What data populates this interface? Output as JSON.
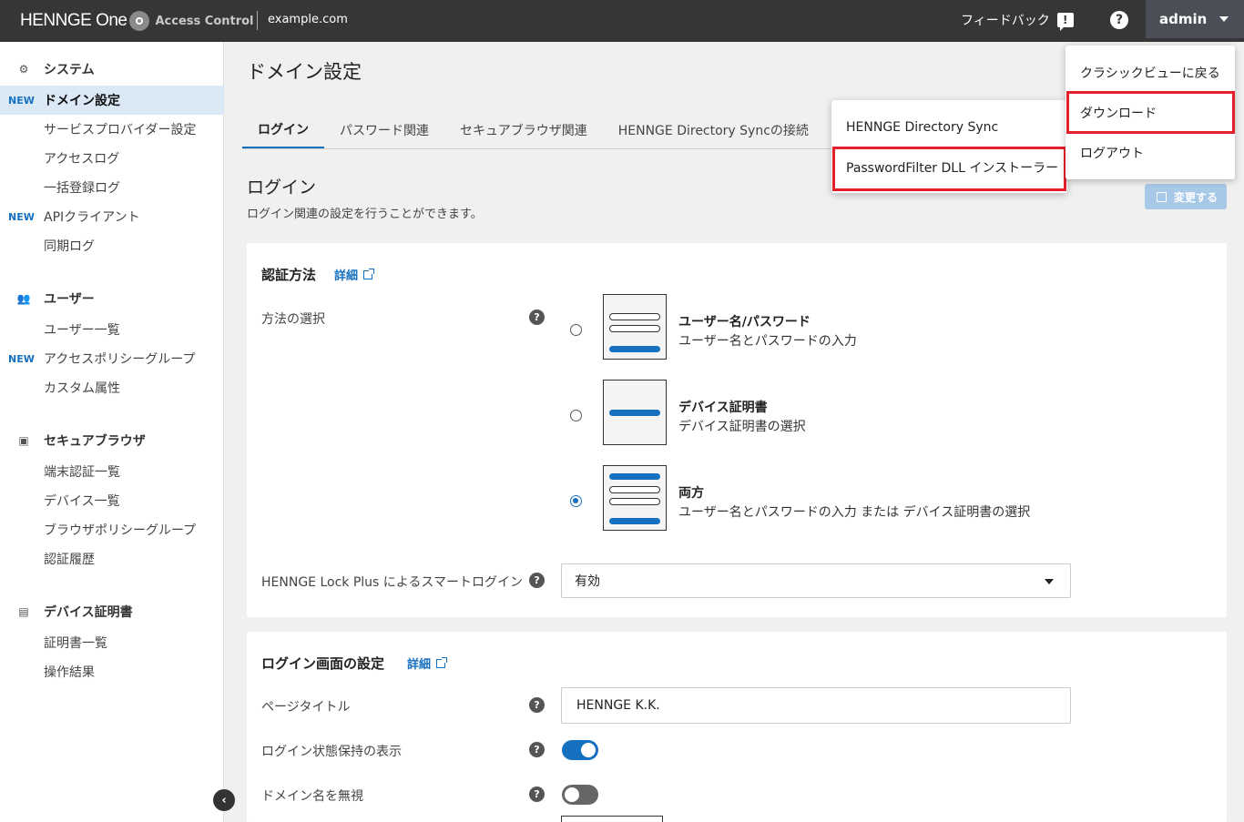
{
  "header": {
    "brand": "HENNGE One",
    "product": "Access Control",
    "domain": "example.com",
    "feedback_label": "フィードバック",
    "feedback_icon": "!",
    "help_icon": "?",
    "user_label": "admin"
  },
  "sidebar": {
    "new_tag": "NEW",
    "sections": [
      {
        "label": "システム",
        "icon": "gear-icon",
        "glyph": "⚙"
      },
      {
        "label": "ユーザー",
        "icon": "users-icon",
        "glyph": "👥"
      },
      {
        "label": "セキュアブラウザ",
        "icon": "browser-icon",
        "glyph": "▣"
      },
      {
        "label": "デバイス証明書",
        "icon": "certificate-icon",
        "glyph": "▤"
      }
    ],
    "items": [
      {
        "label": "ドメイン設定",
        "new": true,
        "active": true
      },
      {
        "label": "サービスプロバイダー設定"
      },
      {
        "label": "アクセスログ"
      },
      {
        "label": "一括登録ログ"
      },
      {
        "label": "APIクライアント",
        "new": true
      },
      {
        "label": "同期ログ"
      },
      {
        "label": "ユーザー一覧"
      },
      {
        "label": "アクセスポリシーグループ",
        "new": true
      },
      {
        "label": "カスタム属性"
      },
      {
        "label": "端末認証一覧"
      },
      {
        "label": "デバイス一覧"
      },
      {
        "label": "ブラウザポリシーグループ"
      },
      {
        "label": "認証履歴"
      },
      {
        "label": "証明書一覧"
      },
      {
        "label": "操作結果"
      }
    ],
    "collapse_glyph": "‹"
  },
  "main": {
    "page_title": "ドメイン設定",
    "tabs": [
      {
        "label": "ログイン",
        "active": true
      },
      {
        "label": "パスワード関連"
      },
      {
        "label": "セキュアブラウザ関連"
      },
      {
        "label": "HENNGE Directory Syncの接続"
      }
    ],
    "section_heading": "ログイン",
    "section_desc": "ログイン関連の設定を行うことができます。",
    "change_button": "変更する",
    "auth_card": {
      "title": "認証方法",
      "detail_link": "詳細",
      "method_label": "方法の選択",
      "options": [
        {
          "title": "ユーザー名/パスワード",
          "desc": "ユーザー名とパスワードの入力",
          "checked": false
        },
        {
          "title": "デバイス証明書",
          "desc": "デバイス証明書の選択",
          "checked": false
        },
        {
          "title": "両方",
          "desc": "ユーザー名とパスワードの入力 または デバイス証明書の選択",
          "checked": true
        }
      ],
      "smart_login_label": "HENNGE Lock Plus によるスマートログイン",
      "smart_login_value": "有効"
    },
    "login_screen_card": {
      "title": "ログイン画面の設定",
      "detail_link": "詳細",
      "page_title_label": "ページタイトル",
      "page_title_value": "HENNGE K.K.",
      "keep_login_label": "ログイン状態保持の表示",
      "keep_login_on": true,
      "ignore_domain_label": "ドメイン名を無視",
      "ignore_domain_on": false
    }
  },
  "user_menu": {
    "items": [
      "クラシックビューに戻る",
      "ダウンロード",
      "ログアウト"
    ],
    "highlighted": "ダウンロード"
  },
  "download_menu": {
    "items": [
      "HENNGE Directory Sync",
      "PasswordFilter DLL インストーラー"
    ],
    "highlighted": "PasswordFilter DLL インストーラー"
  },
  "colors": {
    "accent": "#1570c0",
    "header_bg": "#363636",
    "highlight_border": "#e5202a",
    "active_nav_bg": "#dbe8f6"
  }
}
